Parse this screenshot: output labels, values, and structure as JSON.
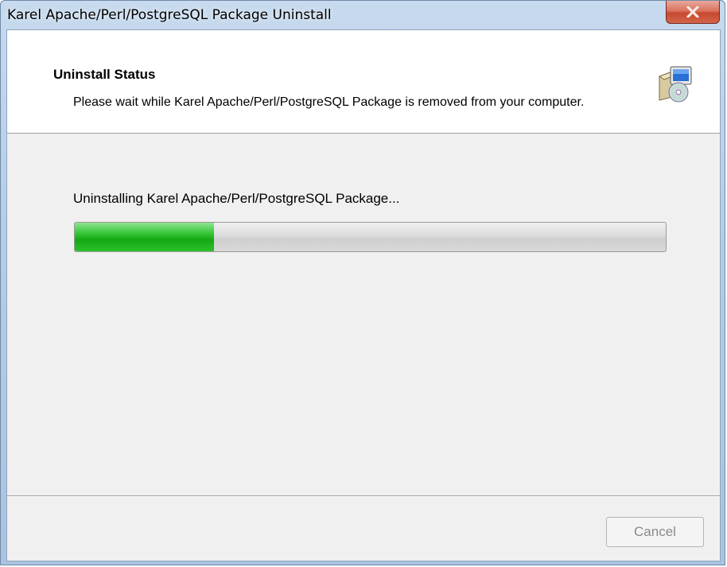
{
  "window": {
    "title": "Karel Apache/Perl/PostgreSQL Package Uninstall",
    "close_icon": "close-icon"
  },
  "header": {
    "title": "Uninstall Status",
    "subtitle": "Please wait while Karel Apache/Perl/PostgreSQL Package is removed from your computer.",
    "icon": "installer-cd-computer-icon"
  },
  "main": {
    "status_text": "Uninstalling Karel Apache/Perl/PostgreSQL Package...",
    "progress_fraction": 0.235
  },
  "footer": {
    "cancel_label": "Cancel",
    "cancel_enabled": false
  },
  "colors": {
    "progress_green": "#14a814",
    "close_red": "#c64a2f",
    "window_frame": "#b5cde6"
  }
}
